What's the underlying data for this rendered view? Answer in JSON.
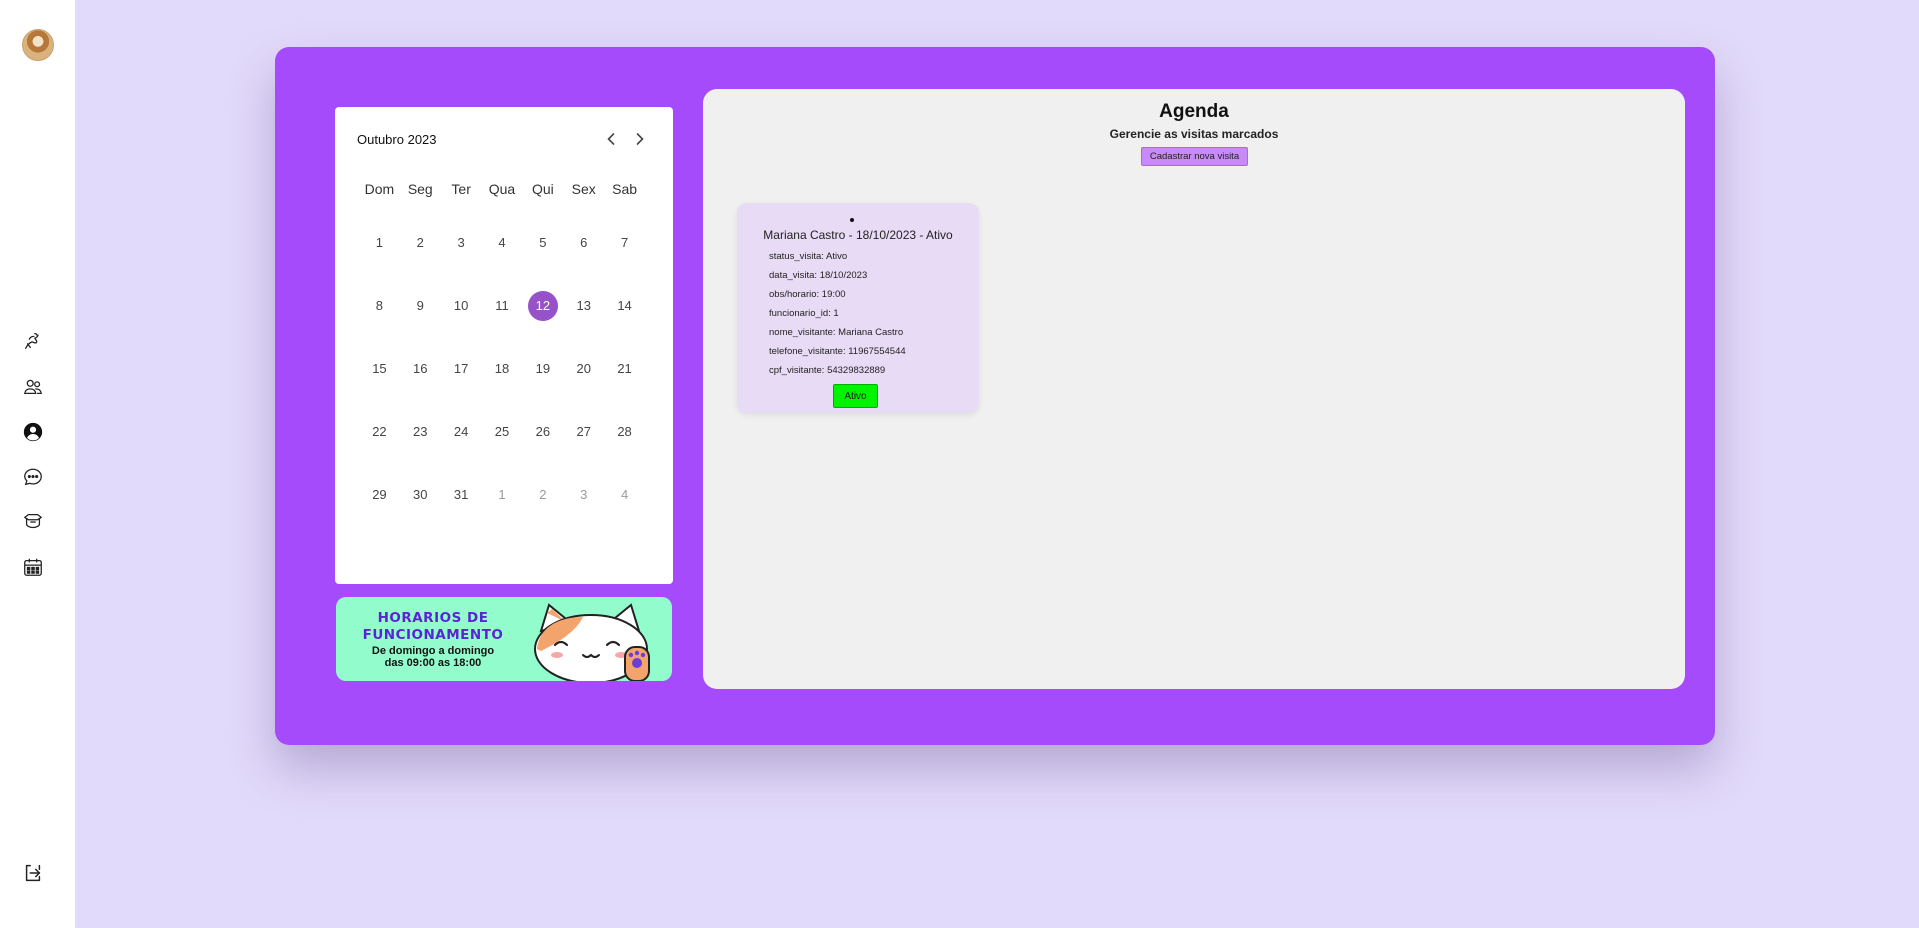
{
  "colors": {
    "page_bg": "#e2dafa",
    "sidebar_bg": "#ffffff",
    "panel_bg": "#a54bfc",
    "agenda_bg": "#f0f0f0",
    "card_bg": "#e8dbf5",
    "selected_day": "#9752c9",
    "new_visit_button": "#c78af8",
    "status_active": "#00f400",
    "banner_bg": "#93fccc"
  },
  "sidebar": {
    "avatar_icon": "user-avatar",
    "items": [
      {
        "icon": "pet-hand-icon"
      },
      {
        "icon": "users-icon"
      },
      {
        "icon": "profile-icon"
      },
      {
        "icon": "chat-icon"
      },
      {
        "icon": "supplies-icon"
      },
      {
        "icon": "calendar-icon"
      }
    ],
    "logout_icon": "logout-icon"
  },
  "calendar": {
    "month_label": "Outubro 2023",
    "weekdays": [
      "Dom",
      "Seg",
      "Ter",
      "Qua",
      "Qui",
      "Sex",
      "Sab"
    ],
    "days": [
      "1",
      "2",
      "3",
      "4",
      "5",
      "6",
      "7",
      "8",
      "9",
      "10",
      "11",
      "12",
      "13",
      "14",
      "15",
      "16",
      "17",
      "18",
      "19",
      "20",
      "21",
      "22",
      "23",
      "24",
      "25",
      "26",
      "27",
      "28",
      "29",
      "30",
      "31",
      "1",
      "2",
      "3",
      "4"
    ],
    "selected_day": "12",
    "next_month_days_count": 4
  },
  "banner": {
    "title_line1": "HORARIOS DE",
    "title_line2": "FUNCIONAMENTO",
    "subtitle_line1": "De domingo a domingo",
    "subtitle_line2": "das 09:00 as 18:00"
  },
  "agenda": {
    "title": "Agenda",
    "subtitle": "Gerencie as visitas marcados",
    "new_visit_label": "Cadastrar nova visita",
    "visits": [
      {
        "title": "Mariana Castro - 18/10/2023 - Ativo",
        "fields": [
          "status_visita: Ativo",
          "data_visita: 18/10/2023",
          "obs/horario: 19:00",
          "funcionario_id: 1",
          "nome_visitante: Mariana Castro",
          "telefone_visitante: 11967554544",
          "cpf_visitante: 54329832889"
        ],
        "status_label": "Ativo"
      }
    ]
  }
}
